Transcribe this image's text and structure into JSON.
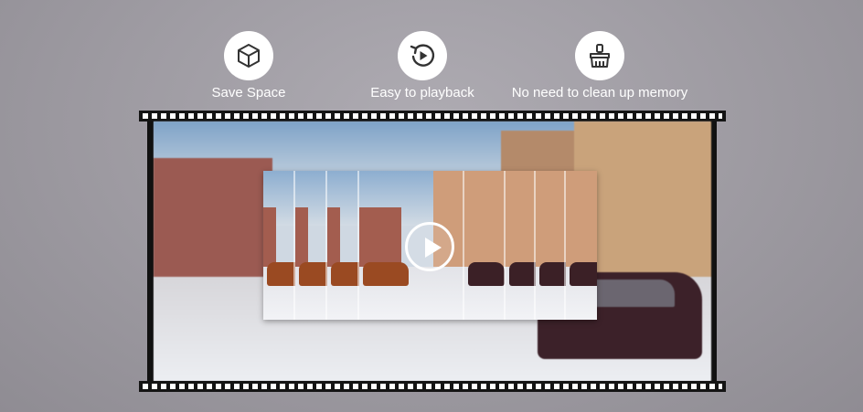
{
  "features": [
    {
      "icon": "cube-icon",
      "label": "Save Space"
    },
    {
      "icon": "playback-icon",
      "label": "Easy to playback"
    },
    {
      "icon": "brush-icon",
      "label": "No need to clean up memory"
    }
  ],
  "player": {
    "play_icon": "play-icon"
  },
  "colors": {
    "background": "#9a979e",
    "film": "#141414",
    "icon": "#333333"
  }
}
